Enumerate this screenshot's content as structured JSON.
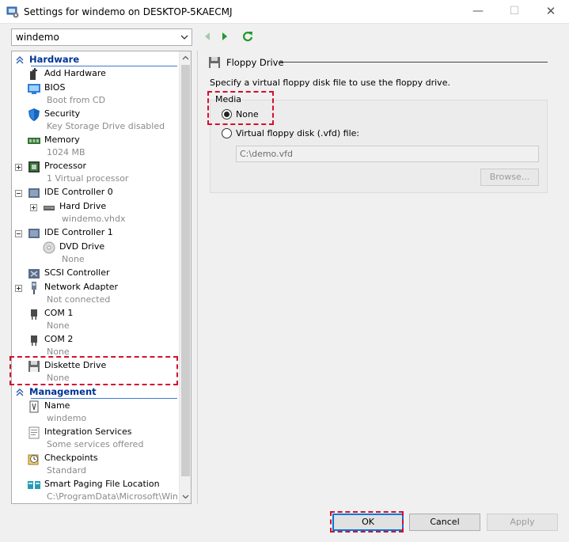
{
  "window": {
    "title": "Settings for windemo on DESKTOP-5KAECMJ",
    "minimize": "—",
    "maximize": "☐",
    "close": "✕"
  },
  "vm_selector": {
    "value": "windemo"
  },
  "tree": {
    "hardware_header": "Hardware",
    "management_header": "Management",
    "hardware_items": [
      {
        "name": "Add Hardware",
        "sub": ""
      },
      {
        "name": "BIOS",
        "sub": "Boot from CD"
      },
      {
        "name": "Security",
        "sub": "Key Storage Drive disabled"
      },
      {
        "name": "Memory",
        "sub": "1024 MB"
      },
      {
        "name": "Processor",
        "sub": "1 Virtual processor"
      },
      {
        "name": "IDE Controller 0",
        "sub": ""
      },
      {
        "name": "Hard Drive",
        "sub": "windemo.vhdx"
      },
      {
        "name": "IDE Controller 1",
        "sub": ""
      },
      {
        "name": "DVD Drive",
        "sub": "None"
      },
      {
        "name": "SCSI Controller",
        "sub": ""
      },
      {
        "name": "Network Adapter",
        "sub": "Not connected"
      },
      {
        "name": "COM 1",
        "sub": "None"
      },
      {
        "name": "COM 2",
        "sub": "None"
      },
      {
        "name": "Diskette Drive",
        "sub": "None"
      }
    ],
    "management_items": [
      {
        "name": "Name",
        "sub": "windemo"
      },
      {
        "name": "Integration Services",
        "sub": "Some services offered"
      },
      {
        "name": "Checkpoints",
        "sub": "Standard"
      },
      {
        "name": "Smart Paging File Location",
        "sub": "C:\\ProgramData\\Microsoft\\Win..."
      }
    ]
  },
  "panel": {
    "title": "Floppy Drive",
    "description": "Specify a virtual floppy disk file to use the floppy drive.",
    "media_label": "Media",
    "option_none": "None",
    "option_vfd": "Virtual floppy disk (.vfd) file:",
    "selected_option": "None",
    "path_value": "C:\\demo.vfd",
    "browse_label": "Browse..."
  },
  "buttons": {
    "ok": "OK",
    "cancel": "Cancel",
    "apply": "Apply"
  },
  "colors": {
    "highlight": "#d3102f",
    "accent": "#0078d7",
    "header_text": "#003399"
  }
}
